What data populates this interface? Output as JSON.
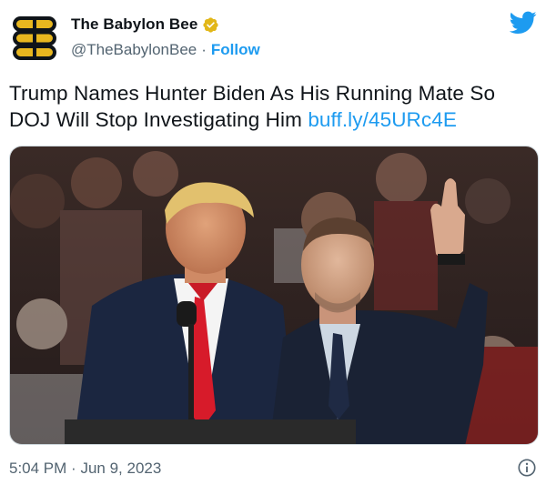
{
  "account": {
    "display_name": "The Babylon Bee",
    "handle": "@TheBabylonBee",
    "separator": "·",
    "follow_label": "Follow"
  },
  "tweet": {
    "text": "Trump Names Hunter Biden As His Running Mate So DOJ Will Stop Investigating Him",
    "link": "buff.ly/45URc4E"
  },
  "footer": {
    "time": "5:04 PM",
    "separator": "·",
    "date": "Jun 9, 2023"
  },
  "icons": {
    "avatar": "bee-logo-icon",
    "verified": "verified-badge-icon",
    "platform": "twitter-bird-icon",
    "info": "info-icon"
  },
  "colors": {
    "accent": "#1d9bf0",
    "text": "#0f1419",
    "secondary": "#536471",
    "verified_gold": "#e2b719"
  }
}
